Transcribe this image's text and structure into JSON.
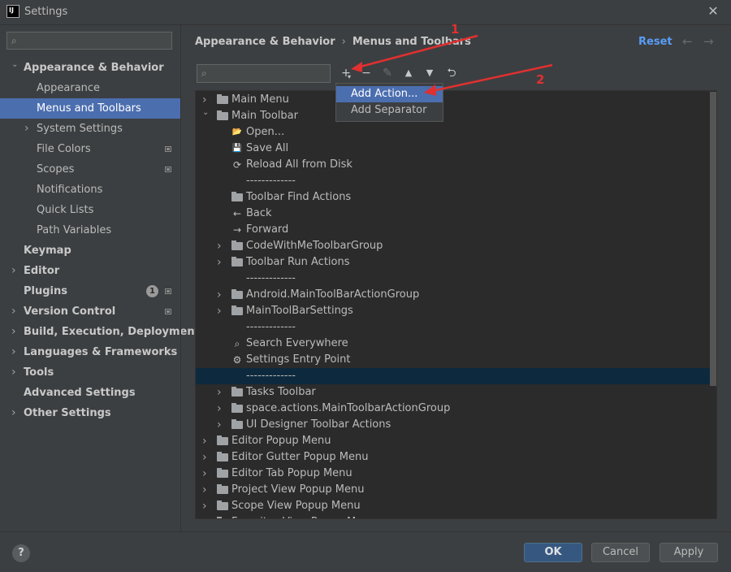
{
  "window": {
    "title": "Settings",
    "icon_text": "IJ"
  },
  "sidebar": {
    "search_placeholder": "",
    "items": [
      {
        "label": "Appearance & Behavior",
        "level": 0,
        "bold": true,
        "expanded": true
      },
      {
        "label": "Appearance",
        "level": 1
      },
      {
        "label": "Menus and Toolbars",
        "level": 1,
        "selected": true
      },
      {
        "label": "System Settings",
        "level": 1,
        "chevron": true
      },
      {
        "label": "File Colors",
        "level": 1,
        "mark": true
      },
      {
        "label": "Scopes",
        "level": 1,
        "mark": true
      },
      {
        "label": "Notifications",
        "level": 1
      },
      {
        "label": "Quick Lists",
        "level": 1
      },
      {
        "label": "Path Variables",
        "level": 1
      },
      {
        "label": "Keymap",
        "level": 0,
        "bold": true
      },
      {
        "label": "Editor",
        "level": 0,
        "bold": true,
        "chevron": true
      },
      {
        "label": "Plugins",
        "level": 0,
        "bold": true,
        "badge": "1",
        "mark": true
      },
      {
        "label": "Version Control",
        "level": 0,
        "bold": true,
        "chevron": true,
        "mark": true
      },
      {
        "label": "Build, Execution, Deployment",
        "level": 0,
        "bold": true,
        "chevron": true
      },
      {
        "label": "Languages & Frameworks",
        "level": 0,
        "bold": true,
        "chevron": true
      },
      {
        "label": "Tools",
        "level": 0,
        "bold": true,
        "chevron": true
      },
      {
        "label": "Advanced Settings",
        "level": 0,
        "bold": true
      },
      {
        "label": "Other Settings",
        "level": 0,
        "bold": true,
        "chevron": true
      }
    ]
  },
  "header": {
    "breadcrumb": [
      "Appearance & Behavior",
      "Menus and Toolbars"
    ],
    "reset_label": "Reset"
  },
  "toolbar": {
    "search_placeholder": ""
  },
  "tree": [
    {
      "label": "Main Menu",
      "indent": 0,
      "arrow": "right",
      "icon": "folder"
    },
    {
      "label": "Main Toolbar",
      "indent": 0,
      "arrow": "down",
      "icon": "folder"
    },
    {
      "label": "Open...",
      "indent": 1,
      "icon": "open-folder"
    },
    {
      "label": "Save All",
      "indent": 1,
      "icon": "save"
    },
    {
      "label": "Reload All from Disk",
      "indent": 1,
      "icon": "refresh"
    },
    {
      "label": "-------------",
      "indent": 1,
      "icon": "none"
    },
    {
      "label": "Toolbar Find Actions",
      "indent": 1,
      "icon": "folder"
    },
    {
      "label": "Back",
      "indent": 1,
      "icon": "arrow-left"
    },
    {
      "label": "Forward",
      "indent": 1,
      "icon": "arrow-right"
    },
    {
      "label": "CodeWithMeToolbarGroup",
      "indent": 1,
      "arrow": "right",
      "icon": "folder"
    },
    {
      "label": "Toolbar Run Actions",
      "indent": 1,
      "arrow": "right",
      "icon": "folder"
    },
    {
      "label": "-------------",
      "indent": 1,
      "icon": "none"
    },
    {
      "label": "Android.MainToolBarActionGroup",
      "indent": 1,
      "arrow": "right",
      "icon": "folder"
    },
    {
      "label": "MainToolBarSettings",
      "indent": 1,
      "arrow": "right",
      "icon": "folder"
    },
    {
      "label": "-------------",
      "indent": 1,
      "icon": "none"
    },
    {
      "label": "Search Everywhere",
      "indent": 1,
      "icon": "search"
    },
    {
      "label": "Settings Entry Point",
      "indent": 1,
      "icon": "gear"
    },
    {
      "label": "-------------",
      "indent": 1,
      "icon": "none",
      "selected": true
    },
    {
      "label": "Tasks Toolbar",
      "indent": 1,
      "arrow": "right",
      "icon": "folder"
    },
    {
      "label": "space.actions.MainToolbarActionGroup",
      "indent": 1,
      "arrow": "right",
      "icon": "folder"
    },
    {
      "label": "UI Designer Toolbar Actions",
      "indent": 1,
      "arrow": "right",
      "icon": "folder"
    },
    {
      "label": "Editor Popup Menu",
      "indent": 0,
      "arrow": "right",
      "icon": "folder"
    },
    {
      "label": "Editor Gutter Popup Menu",
      "indent": 0,
      "arrow": "right",
      "icon": "folder"
    },
    {
      "label": "Editor Tab Popup Menu",
      "indent": 0,
      "arrow": "right",
      "icon": "folder"
    },
    {
      "label": "Project View Popup Menu",
      "indent": 0,
      "arrow": "right",
      "icon": "folder"
    },
    {
      "label": "Scope View Popup Menu",
      "indent": 0,
      "arrow": "right",
      "icon": "folder"
    },
    {
      "label": "Favorites View Popup Menu",
      "indent": 0,
      "arrow": "right",
      "icon": "folder"
    }
  ],
  "popup_menu": {
    "add_action": "Add Action...",
    "add_separator": "Add Separator"
  },
  "annotations": {
    "one": "1",
    "two": "2",
    "color": "#e03030"
  },
  "footer": {
    "help": "?",
    "ok": "OK",
    "cancel": "Cancel",
    "apply": "Apply"
  },
  "colors": {
    "selection": "#4b6eaf",
    "tree_selection": "#0d293e",
    "link": "#589df6"
  }
}
